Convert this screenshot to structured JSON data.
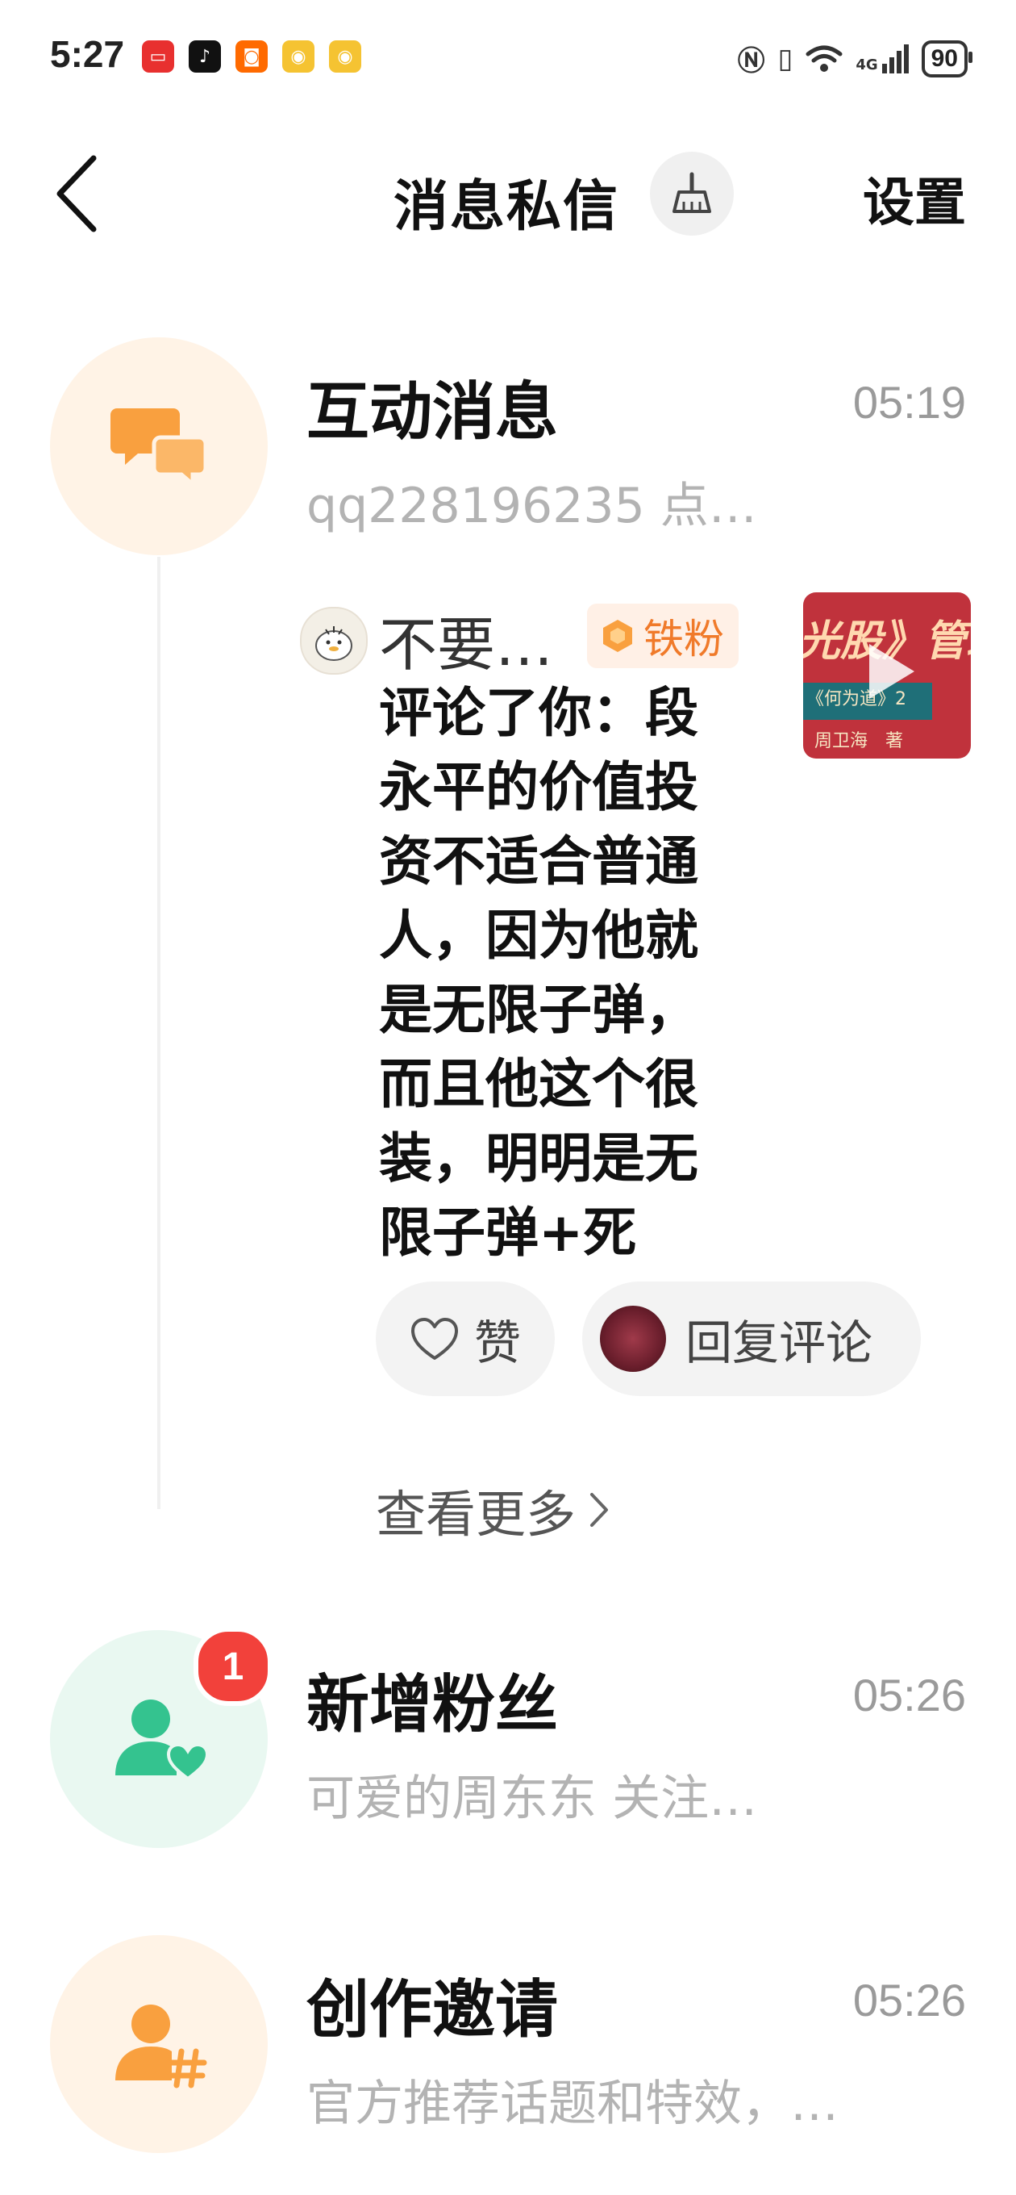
{
  "status_bar": {
    "time": "5:27",
    "battery": "90",
    "network_label": "4G"
  },
  "header": {
    "title": "消息私信",
    "settings_label": "设置"
  },
  "sections": {
    "interaction": {
      "title": "互动消息",
      "time": "05:19",
      "preview": "qq228196235 点…",
      "accent_color": "#f9a03f",
      "bg_color": "#fff3e6"
    },
    "new_fans": {
      "title": "新增粉丝",
      "time": "05:26",
      "preview": "可爱的周东东 关注…",
      "badge_count": "1",
      "accent_color": "#34c38f",
      "bg_color": "#e9f8f1"
    },
    "creation_invite": {
      "title": "创作邀请",
      "time": "05:26",
      "preview": "官方推荐话题和特效，…",
      "accent_color": "#f9a03f",
      "bg_color": "#fff3e6"
    }
  },
  "interaction_detail": {
    "commenter_name": "不要…",
    "fan_badge": "铁粉",
    "comment_text": "评论了你：段永平的价值投资不适合普通人，因为他就是无限子弹，而且他这个很装，明明是无限子弹+死",
    "thumbnail_texts": {
      "line1": "光股》管理",
      "line2": "《何为道》2",
      "line3": "周卫海　著"
    },
    "like_label": "赞",
    "reply_label": "回复评论",
    "see_more_label": "查看更多"
  },
  "icons": {
    "back": "chevron-left-icon",
    "clean": "broom-icon",
    "interaction": "chat-bubbles-icon",
    "new_fans": "user-heart-icon",
    "creation_invite": "user-hashtag-icon",
    "like": "heart-outline-icon",
    "see_more": "chevron-right-icon"
  }
}
